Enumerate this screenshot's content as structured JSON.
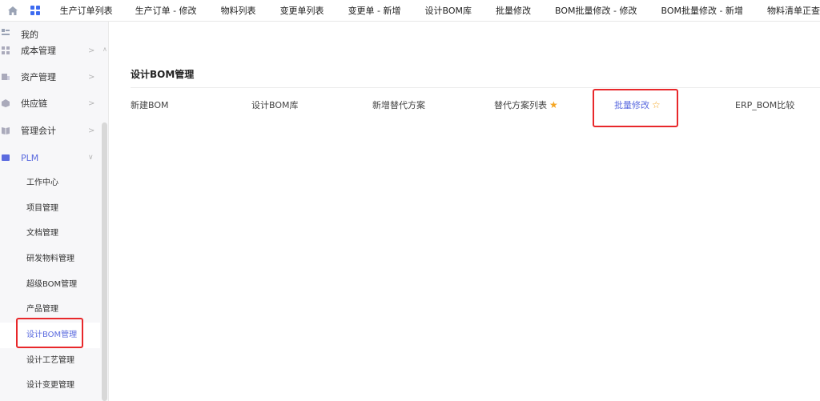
{
  "topbar": {
    "tabs": [
      {
        "label": "生产订单列表"
      },
      {
        "label": "生产订单 - 修改"
      },
      {
        "label": "物料列表"
      },
      {
        "label": "变更单列表"
      },
      {
        "label": "变更单 - 新增"
      },
      {
        "label": "设计BOM库"
      },
      {
        "label": "批量修改"
      },
      {
        "label": "BOM批量修改 - 修改"
      },
      {
        "label": "BOM批量修改 - 新增"
      },
      {
        "label": "物料清单正查"
      }
    ]
  },
  "sidebar": {
    "header": {
      "label": "我的"
    },
    "groups": [
      {
        "label": "成本管理",
        "icon": "grid-icon"
      },
      {
        "label": "资产管理",
        "icon": "asset-icon"
      },
      {
        "label": "供应链",
        "icon": "cube-icon"
      },
      {
        "label": "管理会计",
        "icon": "book-icon"
      },
      {
        "label": "PLM",
        "icon": "plm-icon",
        "expanded": true
      }
    ],
    "sub_items": [
      {
        "label": "工作中心"
      },
      {
        "label": "项目管理"
      },
      {
        "label": "文档管理"
      },
      {
        "label": "研发物料管理"
      },
      {
        "label": "超级BOM管理"
      },
      {
        "label": "产品管理"
      },
      {
        "label": "设计BOM管理",
        "active": true
      },
      {
        "label": "设计工艺管理"
      },
      {
        "label": "设计变更管理"
      }
    ]
  },
  "main": {
    "section_title": "设计BOM管理",
    "links": [
      {
        "label": "新建BOM",
        "star": "none"
      },
      {
        "label": "设计BOM库",
        "star": "none"
      },
      {
        "label": "新增替代方案",
        "star": "none"
      },
      {
        "label": "替代方案列表",
        "star": "filled"
      },
      {
        "label": "批量修改",
        "star": "outline",
        "active": true
      },
      {
        "label": "ERP_BOM比较",
        "star": "none"
      }
    ]
  },
  "colors": {
    "accent": "#5b6bdf",
    "star": "#f5a623",
    "highlight_box": "#e8282b",
    "sidebar_bg": "#f7f7f9"
  }
}
